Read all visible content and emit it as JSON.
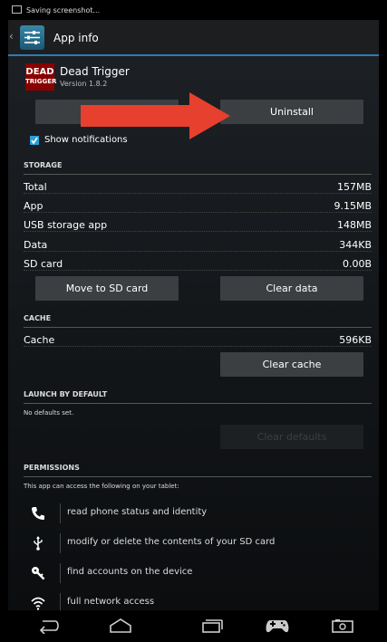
{
  "status_bar": {
    "text": "Saving screenshot..."
  },
  "action_bar": {
    "title": "App info"
  },
  "app": {
    "name": "Dead Trigger",
    "version": "Version 1.8.2",
    "logo_line1": "DEAD",
    "logo_line2": "TRIGGER"
  },
  "buttons": {
    "force_stop": "",
    "uninstall": "Uninstall",
    "move_to_sd": "Move to SD card",
    "clear_data": "Clear data",
    "clear_cache": "Clear cache",
    "clear_defaults": "Clear defaults"
  },
  "notifications": {
    "label": "Show notifications",
    "checked": true
  },
  "storage": {
    "header": "STORAGE",
    "rows": [
      {
        "label": "Total",
        "value": "157MB"
      },
      {
        "label": "App",
        "value": "9.15MB"
      },
      {
        "label": "USB storage app",
        "value": "148MB"
      },
      {
        "label": "Data",
        "value": "344KB"
      },
      {
        "label": "SD card",
        "value": "0.00B"
      }
    ]
  },
  "cache": {
    "header": "CACHE",
    "label": "Cache",
    "value": "596KB"
  },
  "launch": {
    "header": "LAUNCH BY DEFAULT",
    "text": "No defaults set."
  },
  "permissions": {
    "header": "PERMISSIONS",
    "intro": "This app can access the following on your tablet:",
    "items": [
      {
        "icon": "phone-icon",
        "text": "read phone status and identity"
      },
      {
        "icon": "usb-icon",
        "text": "modify or delete the contents of your SD card"
      },
      {
        "icon": "key-icon",
        "text": "find accounts on the device"
      },
      {
        "icon": "wifi-icon",
        "text": "full network access"
      }
    ]
  },
  "colors": {
    "accent": "#2a7fb0",
    "arrow": "#e8402e",
    "checkbox": "#2a9ed8"
  }
}
